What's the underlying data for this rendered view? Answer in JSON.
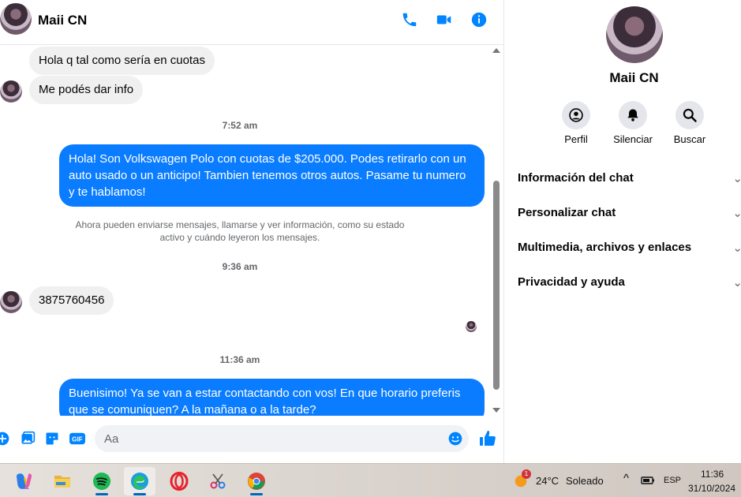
{
  "chat": {
    "contact_name": "Maii CN",
    "messages": [
      {
        "text": "Hola q tal como sería en cuotas"
      },
      {
        "text": "Me podés dar info"
      },
      {
        "text": "7:52 am"
      },
      {
        "text": "Hola! Son Volkswagen Polo con cuotas de $205.000. Podes retirarlo con un auto usado o un anticipo! Tambien tenemos otros autos. Pasame tu numero y te hablamos!"
      },
      {
        "text": "Ahora pueden enviarse mensajes, llamarse y ver información, como su estado activo y cuándo leyeron los mensajes."
      },
      {
        "text": "9:36 am"
      },
      {
        "text": "3875760456"
      },
      {
        "text": "11:36 am"
      },
      {
        "text": "Buenisimo! Ya se van a estar contactando con vos! En que horario preferis que se comuniquen? A la mañana o a la tarde?"
      }
    ],
    "composer": {
      "placeholder": "Aa"
    }
  },
  "info_panel": {
    "name": "Maii CN",
    "actions": [
      {
        "label": "Perfil",
        "icon": "profile-icon"
      },
      {
        "label": "Silenciar",
        "icon": "bell-icon"
      },
      {
        "label": "Buscar",
        "icon": "search-icon"
      }
    ],
    "sections": [
      {
        "label": "Información del chat"
      },
      {
        "label": "Personalizar chat"
      },
      {
        "label": "Multimedia, archivos y enlaces"
      },
      {
        "label": "Privacidad y ayuda"
      }
    ]
  },
  "taskbar": {
    "weather": {
      "temp": "24°C",
      "condition": "Soleado",
      "badge": "1"
    },
    "language": "ESP",
    "time": "11:36",
    "date": "31/10/2024"
  },
  "colors": {
    "accent": "#0084ff",
    "outgoing_bubble": "#0a7cff",
    "incoming_bubble": "#f0f0f0"
  }
}
